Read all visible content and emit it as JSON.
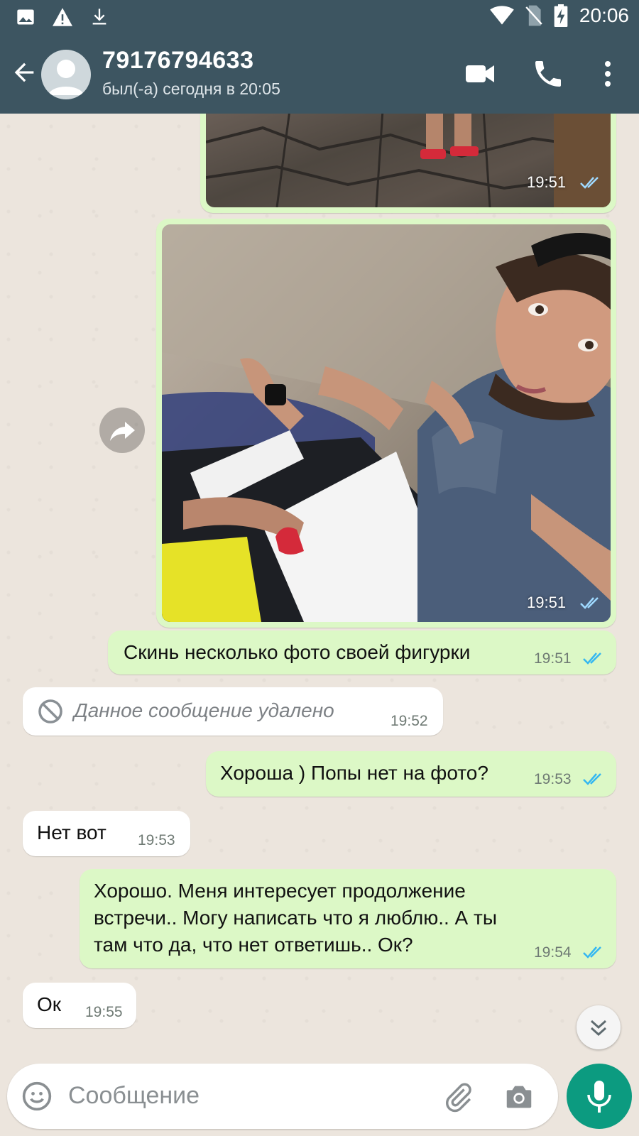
{
  "status_bar": {
    "time": "20:06",
    "left_icons": [
      "image-icon",
      "warning-icon",
      "download-icon"
    ],
    "right_icons": [
      "wifi-icon",
      "no-sim-icon",
      "battery-charging-icon"
    ]
  },
  "header": {
    "contact_name": "79176794633",
    "last_seen": "был(-а) сегодня в 20:05"
  },
  "messages": [
    {
      "type": "image",
      "direction": "out",
      "time": "19:51",
      "status": "read"
    },
    {
      "type": "image",
      "direction": "out",
      "time": "19:51",
      "status": "read"
    },
    {
      "type": "text",
      "direction": "out",
      "text": "Скинь несколько фото своей фигурки",
      "time": "19:51",
      "status": "read"
    },
    {
      "type": "deleted",
      "direction": "in",
      "text": "Данное сообщение удалено",
      "time": "19:52"
    },
    {
      "type": "text",
      "direction": "out",
      "text": "Хороша ) Попы нет на фото?",
      "time": "19:53",
      "status": "read"
    },
    {
      "type": "text",
      "direction": "in",
      "text": "Нет вот",
      "time": "19:53"
    },
    {
      "type": "text",
      "direction": "out",
      "lines": [
        "Хорошо. Меня интересует продолжение",
        "встречи.. Могу написать что я люблю.. А ты",
        "там что да, что нет ответишь.. Ок?"
      ],
      "time": "19:54",
      "status": "read"
    },
    {
      "type": "text",
      "direction": "in",
      "text": "Ок",
      "time": "19:55"
    }
  ],
  "composer": {
    "placeholder": "Сообщение"
  },
  "colors": {
    "header": "#3d5561",
    "outgoing_bubble": "#dcf8c6",
    "incoming_bubble": "#ffffff",
    "read_ticks": "#34b7f1",
    "mic_button": "#0c9b80"
  }
}
